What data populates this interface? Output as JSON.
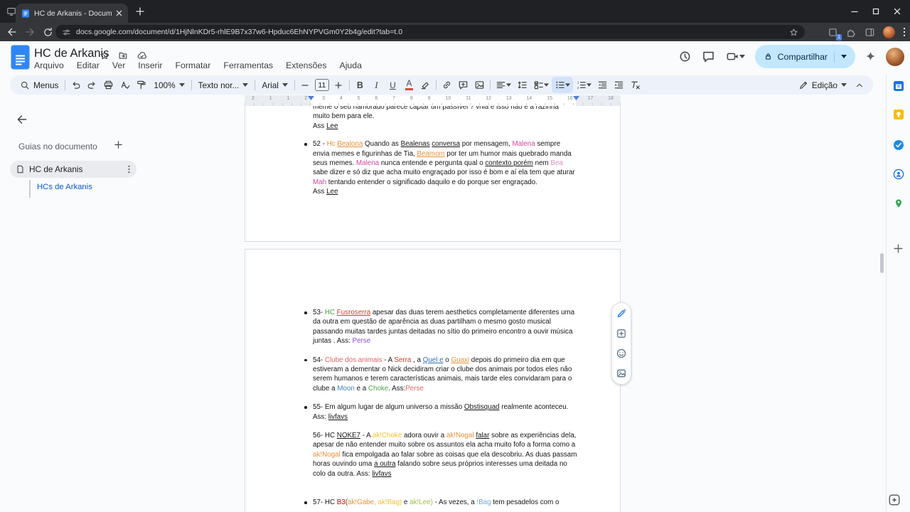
{
  "browser": {
    "tab_title": "HC de Arkanis - Documentos G",
    "url": "docs.google.com/document/d/1HjNlnKDr5-rhlE9B7x37w6-Hpduc6EhNYPVGm0Y2b4g/edit?tab=t.0",
    "extension_badge": "1"
  },
  "header": {
    "title": "HC de Arkanis",
    "menus": [
      "Arquivo",
      "Editar",
      "Ver",
      "Inserir",
      "Formatar",
      "Ferramentas",
      "Extensões",
      "Ajuda"
    ],
    "share_label": "Compartilhar"
  },
  "toolbar": {
    "menus_label": "Menus",
    "zoom": "100%",
    "style_name": "Texto nor...",
    "font_name": "Arial",
    "font_size": "11",
    "bold_label": "B",
    "italic_label": "I",
    "underline_label": "U",
    "textcolor_label": "A",
    "mode_label": "Edição"
  },
  "panel": {
    "heading": "Guias no documento",
    "doc_tab": "HC de Arkanis",
    "sub_tab": "HCs de Arkanis"
  },
  "ruler": {
    "numbers": [
      "2",
      "1",
      "1",
      "2",
      "3",
      "4",
      "5",
      "6",
      "7",
      "8",
      "9",
      "10",
      "11",
      "12",
      "13",
      "14",
      "15",
      "16",
      "17",
      "18"
    ]
  },
  "accent_colors": {
    "share_bg": "#c2e7ff",
    "docs_blue": "#3086f6",
    "marker_blue": "#4c7fd6"
  },
  "doc": {
    "page1": {
      "cut_line": [
        {
          "t": "meme o seu namorado parece captar um passível ? vnia e isso não é a razinha"
        }
      ],
      "cont_line": [
        {
          "t": "muito bem para ele."
        }
      ],
      "sig1": [
        {
          "t": "Ass "
        },
        {
          "t": "Lee",
          "u": true
        }
      ],
      "hc52": [
        {
          "t": "52 - "
        },
        {
          "t": "Hc ",
          "c": "#e69138"
        },
        {
          "t": "Bealona",
          "c": "#e69138",
          "u": true
        },
        {
          "t": " Quando as "
        },
        {
          "t": "Bealenas",
          "u": true
        },
        {
          "t": " "
        },
        {
          "t": "conversa",
          "u": true
        },
        {
          "t": " por mensagem, "
        },
        {
          "t": "Malena",
          "c": "#d5459c"
        },
        {
          "t": " sempre envia memes e figurinhas de Tia, "
        },
        {
          "t": "Beamom",
          "c": "#e69138",
          "u": true
        },
        {
          "t": " por ter um humor mais quebrado manda seus memes. "
        },
        {
          "t": "Malena",
          "c": "#d5459c"
        },
        {
          "t": " nunca entende e pergunta qual o "
        },
        {
          "t": "contexto porém",
          "u": true
        },
        {
          "t": " nem "
        },
        {
          "t": "Bea",
          "c": "#d98ec0"
        },
        {
          "t": " sabe dizer e só diz que acha muito engraçado por isso é bom e aí ela tem que aturar "
        },
        {
          "t": "Mah",
          "c": "#d5459c"
        },
        {
          "t": " tentando entender o significado daquilo e do porque ser engraçado."
        }
      ],
      "sig2": [
        {
          "t": "Ass "
        },
        {
          "t": "Lee",
          "u": true
        }
      ]
    },
    "page2": {
      "hc53": [
        {
          "t": "53- "
        },
        {
          "t": "HC ",
          "c": "#44a044"
        },
        {
          "t": "Fusroserra",
          "c": "#cc4125",
          "u": true
        },
        {
          "t": " apesar das duas terem aesthetics completamente diferentes uma da outra em questão de aparência as duas partilham o mesmo gosto musical passando muitas tardes juntas deitadas no sítio do primeiro encontro a ouvir música juntas . Ass: "
        },
        {
          "t": "Perse",
          "c": "#8a4fd6"
        }
      ],
      "hc54": [
        {
          "t": "54- "
        },
        {
          "t": "Clube dos animais",
          "c": "#e06666"
        },
        {
          "t": " - A "
        },
        {
          "t": "Serra",
          "c": "#cc4125"
        },
        {
          "t": " , a "
        },
        {
          "t": "Quel e",
          "c": "#2e74b5",
          "u": true
        },
        {
          "t": " o "
        },
        {
          "t": "Guaxi",
          "c": "#e69138",
          "u": true
        },
        {
          "t": " depois do primeiro dia em que estiveram a dementar o Nick decidiram criar o clube dos animais por todos eles não serem humanos e terem características animais, mais tarde eles convidaram para o clube a "
        },
        {
          "t": "Moon",
          "c": "#3d85c6"
        },
        {
          "t": " e a "
        },
        {
          "t": "Choke",
          "c": "#52a352"
        },
        {
          "t": ". Ass:"
        },
        {
          "t": "Perse",
          "c": "#e06666"
        }
      ],
      "hc55": [
        {
          "t": "55-  Em algum lugar de algum universo a missão "
        },
        {
          "t": "Obstisquad",
          "u": true
        },
        {
          "t": " realmente aconteceu."
        },
        {
          "br": true
        },
        {
          "t": "Ass: "
        },
        {
          "t": "livfavs",
          "u": true
        }
      ],
      "hc56": [
        {
          "t": "56- HC "
        },
        {
          "t": "NOKE7",
          "u": true
        },
        {
          "t": " - A "
        },
        {
          "t": "ak!Choke",
          "c": "#f1c232"
        },
        {
          "t": " adora ouvir a "
        },
        {
          "t": "ak!Nogal",
          "c": "#e69138"
        },
        {
          "t": " "
        },
        {
          "t": "falar",
          "u": true
        },
        {
          "t": " sobre as experiências dela, apesar de não entender muito sobre os assuntos ela acha muito fofo a forma como a "
        },
        {
          "t": "ak!Nogal",
          "c": "#e69138"
        },
        {
          "t": " fica empolgada ao falar sobre as coisas que ela descobriu. As duas passam horas ouvindo uma "
        },
        {
          "t": "a outra",
          "u": true
        },
        {
          "t": " falando sobre seus próprios interesses uma deitada no colo da outra.   Ass: "
        },
        {
          "t": "livfavs",
          "u": true
        }
      ],
      "hc57": [
        {
          "t": "57- HC "
        },
        {
          "t": "B3(",
          "c": "#cc0000"
        },
        {
          "t": "ak!Gabe,",
          "c": "#e69138"
        },
        {
          "t": " "
        },
        {
          "t": "ak!Bag)",
          "c": "#f1c232"
        },
        {
          "t": " e "
        },
        {
          "t": "ak!Lee)",
          "c": "#9fc246"
        },
        {
          "t": " - As vezes, a "
        },
        {
          "t": "!Bag",
          "c": "#6fa8dc"
        },
        {
          "t": " tem pesadelos com o"
        }
      ]
    }
  }
}
